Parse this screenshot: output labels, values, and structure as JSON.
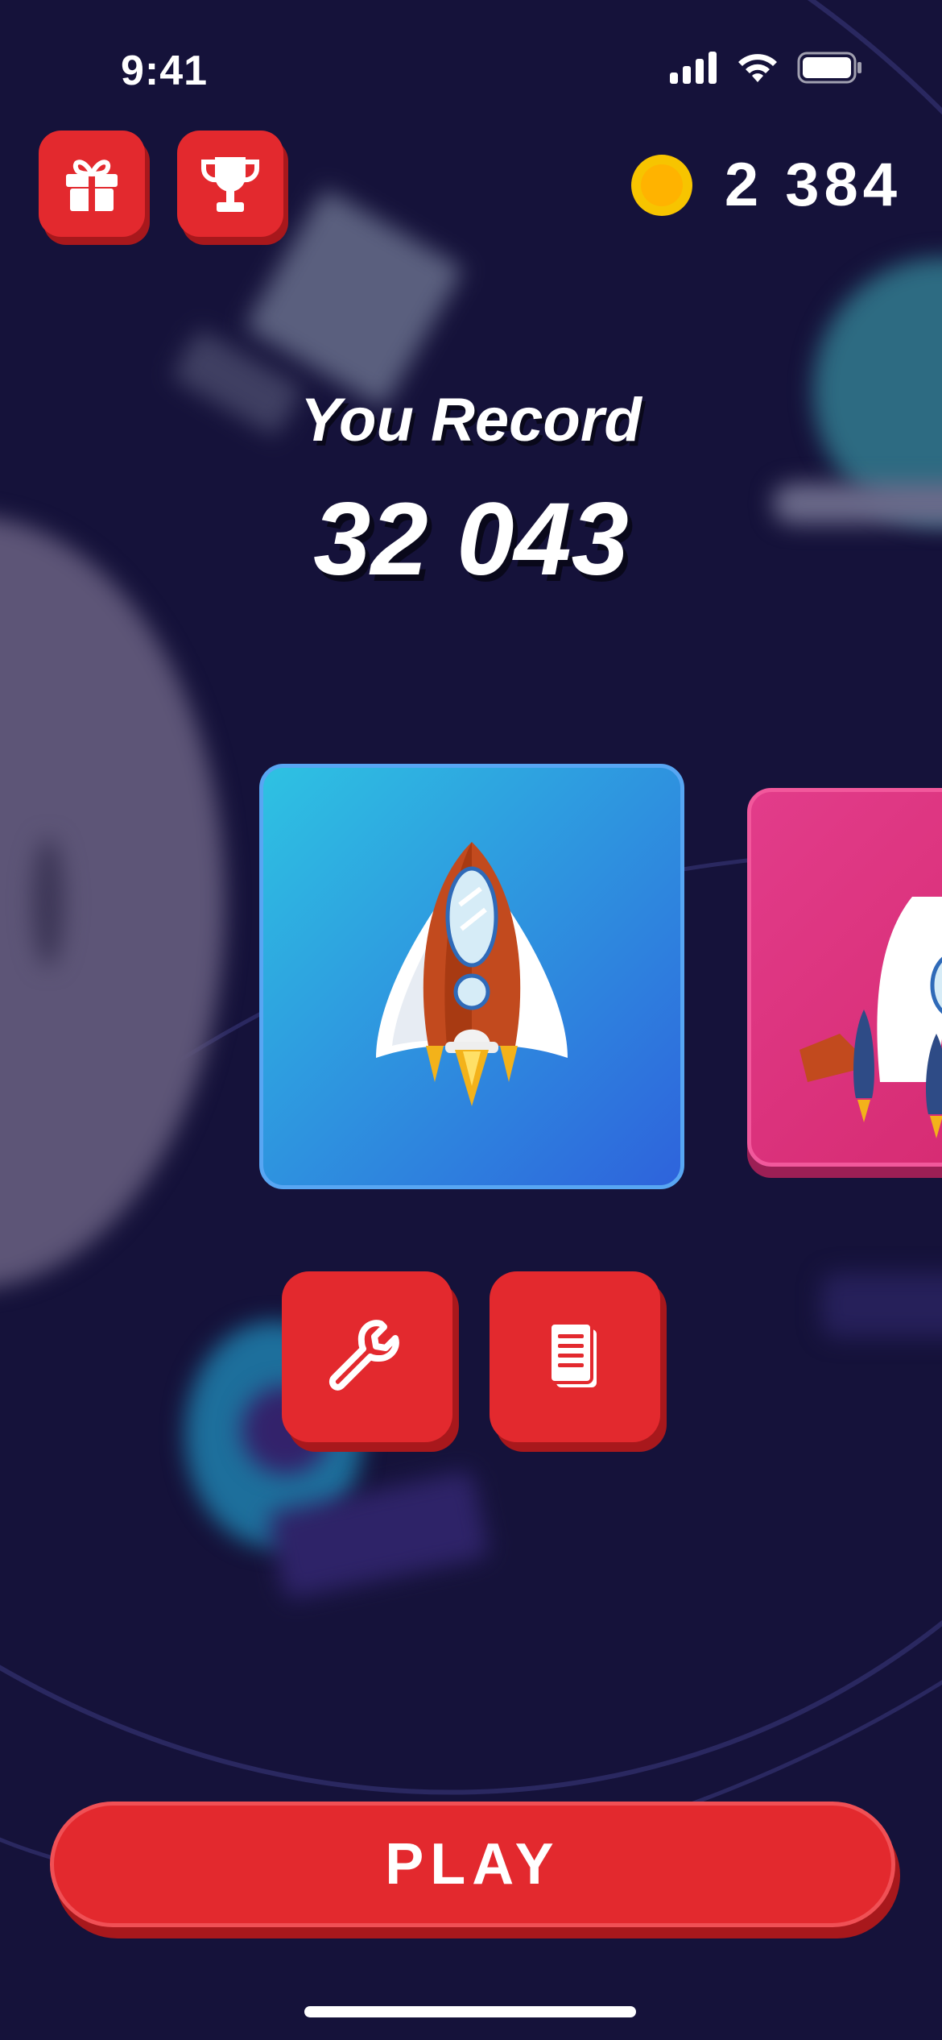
{
  "status": {
    "time": "9:41"
  },
  "top": {
    "coins": "2 384"
  },
  "record": {
    "label": "You Record",
    "value": "32 043"
  },
  "play": {
    "label": "PLAY"
  },
  "colors": {
    "background": "#15123a",
    "accent": "#e3292e",
    "card_blue_start": "#2ec2e2",
    "card_blue_end": "#2e63dc",
    "card_pink": "#e23c8a",
    "coin": "#f7c400"
  },
  "icons": {
    "gift": "gift-icon",
    "trophy": "trophy-icon",
    "wrench": "wrench-icon",
    "document": "document-icon",
    "coin": "coin-icon"
  }
}
